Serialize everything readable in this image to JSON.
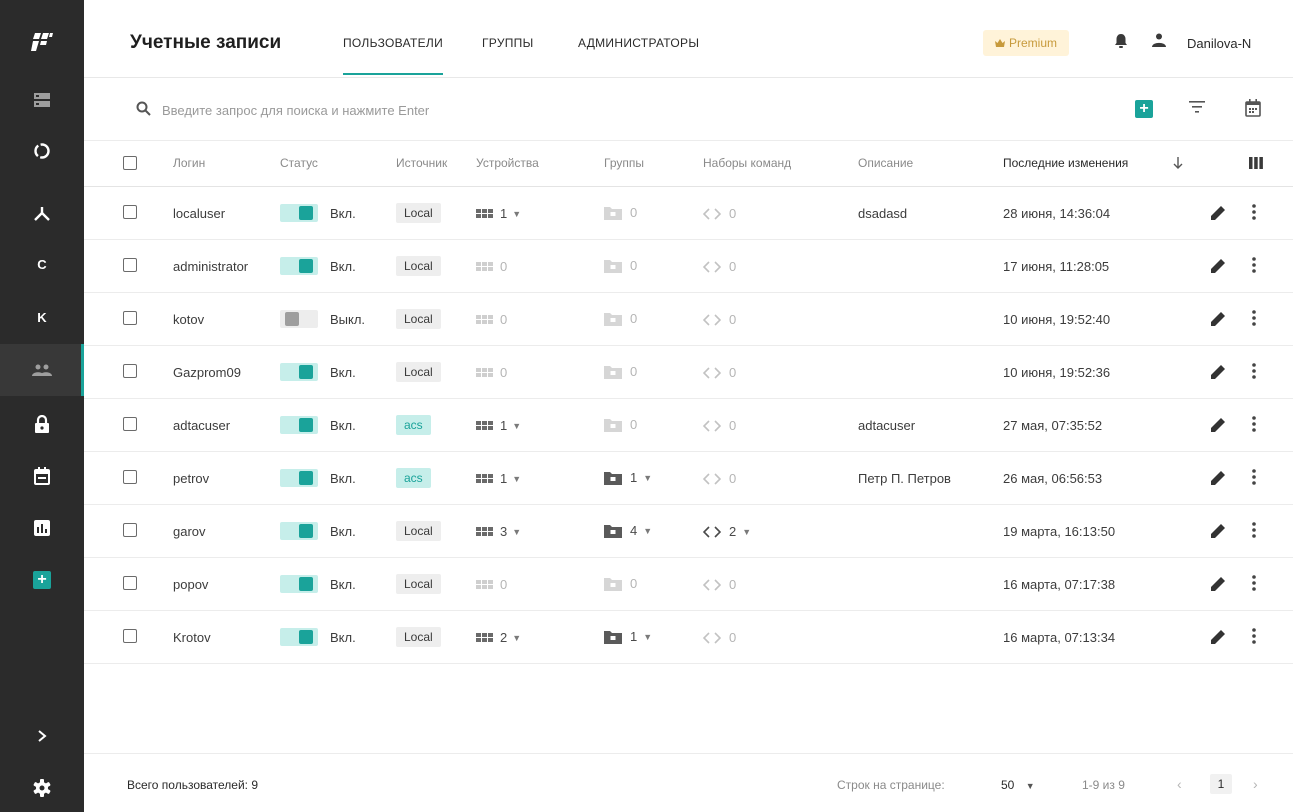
{
  "sidebar": {
    "letters": {
      "c": "C",
      "k": "K"
    }
  },
  "header": {
    "title": "Учетные записи",
    "tabs": [
      {
        "label": "ПОЛЬЗОВАТЕЛИ",
        "active": true
      },
      {
        "label": "ГРУППЫ",
        "active": false
      },
      {
        "label": "АДМИНИСТРАТОРЫ",
        "active": false
      }
    ],
    "premium_label": "Premium",
    "username": "Danilova-N"
  },
  "search": {
    "placeholder": "Введите запрос для поиска и нажмите Enter",
    "value": ""
  },
  "table": {
    "columns": {
      "login": "Логин",
      "status": "Статус",
      "source": "Источник",
      "devices": "Устройства",
      "groups": "Группы",
      "commands": "Наборы команд",
      "description": "Описание",
      "changed": "Последние изменения"
    },
    "rows": [
      {
        "login": "localuser",
        "status": "Вкл.",
        "enabled": true,
        "source": "Local",
        "devices": "1",
        "groups": "0",
        "commands": "0",
        "description": "dsadasd",
        "changed": "28 июня, 14:36:04"
      },
      {
        "login": "administrator",
        "status": "Вкл.",
        "enabled": true,
        "source": "Local",
        "devices": "0",
        "groups": "0",
        "commands": "0",
        "description": "",
        "changed": "17 июня, 11:28:05"
      },
      {
        "login": "kotov",
        "status": "Выкл.",
        "enabled": false,
        "source": "Local",
        "devices": "0",
        "groups": "0",
        "commands": "0",
        "description": "",
        "changed": "10 июня, 19:52:40"
      },
      {
        "login": "Gazprom09",
        "status": "Вкл.",
        "enabled": true,
        "source": "Local",
        "devices": "0",
        "groups": "0",
        "commands": "0",
        "description": "",
        "changed": "10 июня, 19:52:36"
      },
      {
        "login": "adtacuser",
        "status": "Вкл.",
        "enabled": true,
        "source": "acs",
        "devices": "1",
        "groups": "0",
        "commands": "0",
        "description": "adtacuser",
        "changed": "27 мая, 07:35:52"
      },
      {
        "login": "petrov",
        "status": "Вкл.",
        "enabled": true,
        "source": "acs",
        "devices": "1",
        "groups": "1",
        "commands": "0",
        "description": "Петр П. Петров",
        "changed": "26 мая, 06:56:53"
      },
      {
        "login": "garov",
        "status": "Вкл.",
        "enabled": true,
        "source": "Local",
        "devices": "3",
        "groups": "4",
        "commands": "2",
        "description": "",
        "changed": "19 марта, 16:13:50"
      },
      {
        "login": "popov",
        "status": "Вкл.",
        "enabled": true,
        "source": "Local",
        "devices": "0",
        "groups": "0",
        "commands": "0",
        "description": "",
        "changed": "16 марта, 07:17:38"
      },
      {
        "login": "Krotov",
        "status": "Вкл.",
        "enabled": true,
        "source": "Local",
        "devices": "2",
        "groups": "1",
        "commands": "0",
        "description": "",
        "changed": "16 марта, 07:13:34"
      }
    ]
  },
  "footer": {
    "total": "Всего пользователей: 9",
    "rows_per_page_label": "Строк на странице:",
    "rows_per_page": "50",
    "range": "1-9 из 9",
    "page": "1"
  },
  "colors": {
    "accent": "#1aa39a",
    "accent_light": "#c6eeea",
    "sidebar_bg": "#2b2b2b",
    "premium_bg": "#fff3d9",
    "premium_text": "#c79a3c"
  }
}
